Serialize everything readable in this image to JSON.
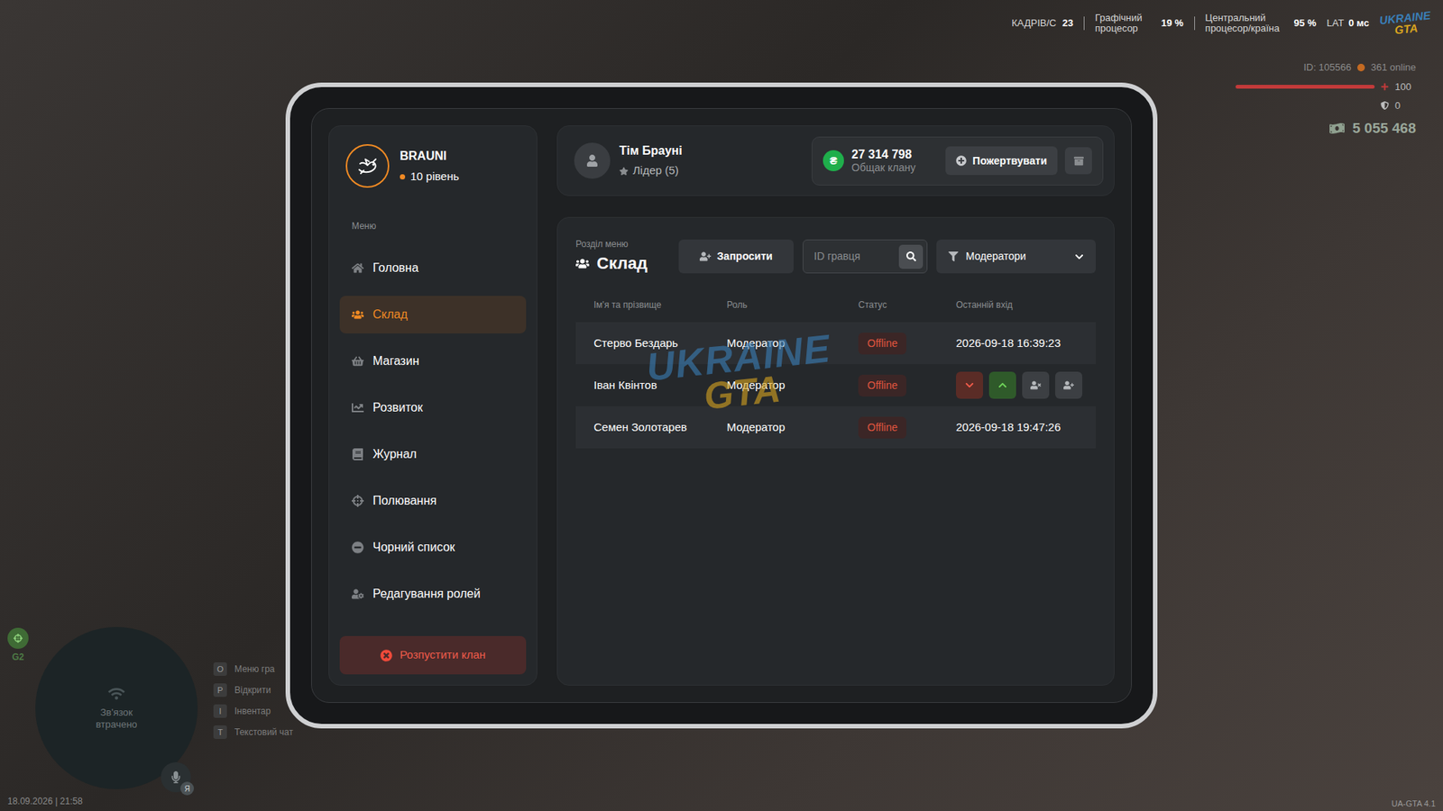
{
  "hud": {
    "fps_label": "КАДРІВ/С",
    "fps": "23",
    "gpu_label": "Графічний процесор",
    "gpu": "19 %",
    "cpu_label": "Центральний процесор/країна",
    "cpu": "95 %",
    "lat_label": "LAT",
    "lat": "0 мс",
    "player_id": "ID: 105566",
    "online": "361 online",
    "health": "100",
    "health_level": 1,
    "armor": "0",
    "money": "5 055 468"
  },
  "watermark": {
    "line1": "UKRAINE",
    "line2": "GTA"
  },
  "minimap": {
    "status": "Зв'язок втрачено",
    "zone": "G2",
    "mic_badge": "Я"
  },
  "keybinds": [
    {
      "key": "O",
      "label": "Меню гра"
    },
    {
      "key": "P",
      "label": "Відкрити"
    },
    {
      "key": "I",
      "label": "Інвентар"
    },
    {
      "key": "T",
      "label": "Текстовий чат"
    }
  ],
  "datetime": "18.09.2026 | 21:58",
  "version": "UA-GTA 4.1",
  "clan": {
    "name": "BRAUNI",
    "level": "10 рівень",
    "menu_label": "Меню",
    "sidebar": {
      "items": [
        {
          "label": "Головна",
          "selected": false
        },
        {
          "label": "Склад",
          "selected": true
        },
        {
          "label": "Магазин",
          "selected": false
        },
        {
          "label": "Розвиток",
          "selected": false
        },
        {
          "label": "Журнал",
          "selected": false
        },
        {
          "label": "Полювання",
          "selected": false
        },
        {
          "label": "Чорний список",
          "selected": false
        },
        {
          "label": "Редагування ролей",
          "selected": false
        }
      ],
      "disband_button": "Розпустити клан"
    },
    "leader": {
      "name": "Тім Брауні",
      "role": "Лідер (5)"
    },
    "treasury": {
      "currency_symbol": "₴",
      "amount": "27 314 798",
      "label": "Общак клану",
      "donate_button": "Пожертвувати"
    },
    "section": {
      "caption": "Розділ меню",
      "title": "Склад"
    },
    "invite_button": "Запросити",
    "search": {
      "placeholder": "ID гравця"
    },
    "filter": {
      "value": "Модератори"
    },
    "table": {
      "columns": [
        "Ім'я та прізвище",
        "Роль",
        "Статус",
        "Останній вхід"
      ],
      "rows": [
        {
          "name": "Стерво Бездарь",
          "role": "Модератор",
          "status": "Offline",
          "last_login": "2026-09-18 16:39:23",
          "actions_shown": false
        },
        {
          "name": "Іван Квінтов",
          "role": "Модератор",
          "status": "Offline",
          "actions_shown": true
        },
        {
          "name": "Семен Золотарев",
          "role": "Модератор",
          "status": "Offline",
          "last_login": "2026-09-18 19:47:26",
          "actions_shown": false
        }
      ]
    }
  }
}
